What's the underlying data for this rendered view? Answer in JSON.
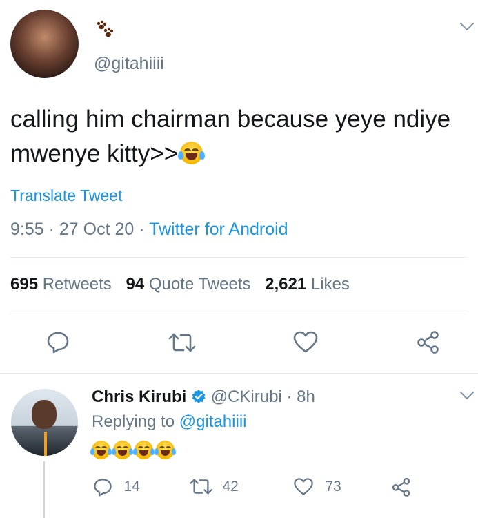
{
  "tweet": {
    "handle": "@gitahiiii",
    "name_icon": "paw-prints-icon",
    "text": "calling him chairman because yeye ndiye mwenye kitty>>",
    "text_emoji": "face-with-tears-of-joy-icon",
    "translate": "Translate Tweet",
    "time": "9:55",
    "sep1": "·",
    "date": "27 Oct 20",
    "sep2": "·",
    "source": "Twitter for Android",
    "stats": {
      "retweets_count": "695",
      "retweets_label": "Retweets",
      "quotes_count": "94",
      "quotes_label": "Quote Tweets",
      "likes_count": "2,621",
      "likes_label": "Likes"
    }
  },
  "reply": {
    "name": "Chris Kirubi",
    "verified_icon": "verified-badge-icon",
    "handle": "@CKirubi",
    "sep": "·",
    "age": "8h",
    "replying_prefix": "Replying to",
    "replying_handle": "@gitahiiii",
    "emoji_count": 4,
    "reply_count": "14",
    "retweet_count": "42",
    "like_count": "73"
  },
  "colors": {
    "text": "#14171a",
    "muted": "#657786",
    "link": "#1b95e0",
    "divider": "#e6ecf0"
  }
}
